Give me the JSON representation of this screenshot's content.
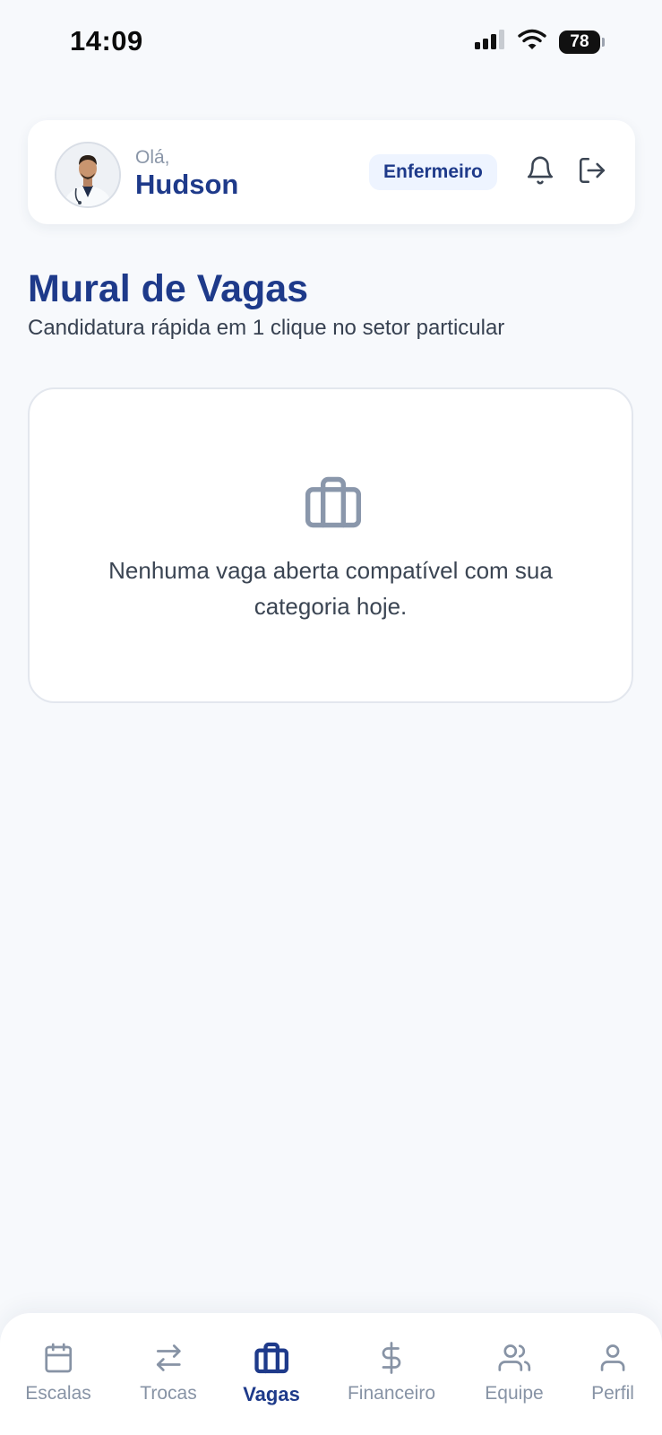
{
  "status_bar": {
    "time": "14:09",
    "battery": "78"
  },
  "header": {
    "greeting": "Olá,",
    "user_name": "Hudson",
    "role_badge": "Enfermeiro"
  },
  "page": {
    "title": "Mural de Vagas",
    "subtitle": "Candidatura rápida em 1 clique no setor particular"
  },
  "empty_state": {
    "icon": "briefcase-icon",
    "message": "Nenhuma vaga aberta compatível com sua categoria hoje."
  },
  "bottom_nav": {
    "items": [
      {
        "label": "Escalas",
        "icon": "calendar-icon"
      },
      {
        "label": "Trocas",
        "icon": "swap-arrows-icon"
      },
      {
        "label": "Vagas",
        "icon": "briefcase-icon",
        "active": true
      },
      {
        "label": "Financeiro",
        "icon": "dollar-icon"
      },
      {
        "label": "Equipe",
        "icon": "users-icon"
      },
      {
        "label": "Perfil",
        "icon": "user-icon"
      }
    ]
  },
  "colors": {
    "brand": "#1e3a8a",
    "background": "#f7f9fc",
    "muted": "#8793a5",
    "badge_bg": "#eef4ff"
  }
}
